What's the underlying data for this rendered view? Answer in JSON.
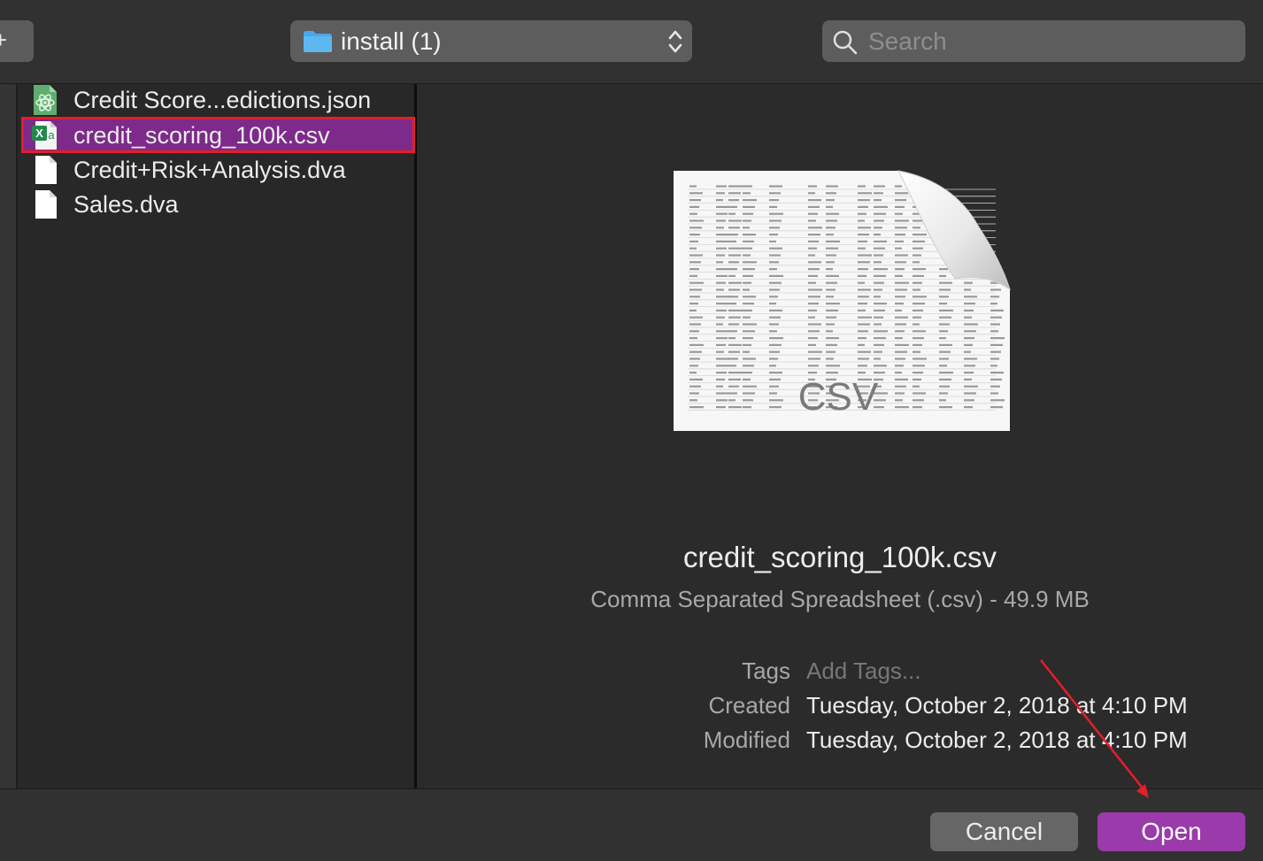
{
  "toolbar": {
    "new_folder_glyph": "+",
    "location_label": "install (1)",
    "search_placeholder": "Search"
  },
  "files": [
    {
      "name": "Credit Score...edictions.json",
      "icon": "atom-json-file-icon",
      "selected": false
    },
    {
      "name": "credit_scoring_100k.csv",
      "icon": "excel-csv-file-icon",
      "selected": true
    },
    {
      "name": "Credit+Risk+Analysis.dva",
      "icon": "blank-document-icon",
      "selected": false
    },
    {
      "name": "Sales.dva",
      "icon": "blank-document-icon",
      "selected": false
    }
  ],
  "preview": {
    "thumbnail_label": "CSV",
    "file_name": "credit_scoring_100k.csv",
    "kind_size": "Comma Separated Spreadsheet (.csv) - 49.9 MB",
    "tags_label": "Tags",
    "tags_placeholder": "Add Tags...",
    "created_label": "Created",
    "created_value": "Tuesday, October 2, 2018 at 4:10 PM",
    "modified_label": "Modified",
    "modified_value": "Tuesday, October 2, 2018 at 4:10 PM"
  },
  "buttons": {
    "cancel": "Cancel",
    "open": "Open"
  },
  "colors": {
    "selection": "#7d2a8a",
    "open_button": "#9b3aaa",
    "highlight_box": "#e0202a",
    "annotation_arrow": "#e0202a"
  }
}
